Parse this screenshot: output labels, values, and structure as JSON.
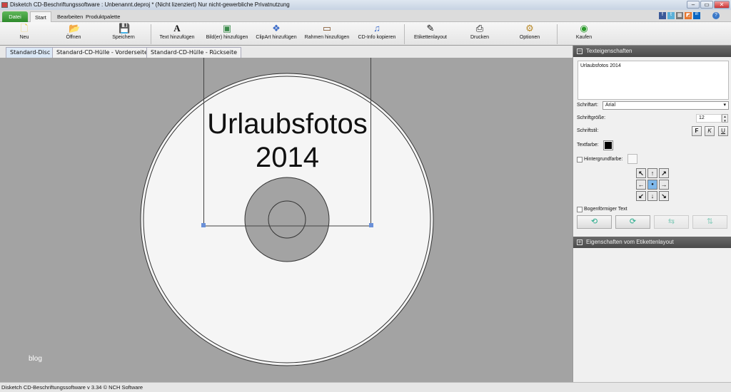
{
  "window": {
    "title": "Disketch CD-Beschriftungssoftware : Unbenannt.deproj * (Nicht lizenziert) Nur nicht-gewerbliche Privatnutzung",
    "min": "–",
    "max": "▭",
    "close": "✕"
  },
  "menu": {
    "tabs": [
      "Datei",
      "Start",
      "Bearbeiten",
      "Produktpalette"
    ],
    "social": [
      "f",
      "t",
      "▦",
      "◩",
      "in"
    ],
    "help": "?"
  },
  "toolbar": [
    {
      "label": "Neu",
      "icon": "new-icon",
      "glyph": "🗋"
    },
    {
      "label": "Öffnen",
      "icon": "open-icon",
      "glyph": "📂"
    },
    {
      "label": "Speichern",
      "icon": "save-icon",
      "glyph": "💾"
    },
    {
      "label": "Text hinzufügen",
      "icon": "text-icon",
      "glyph": "A"
    },
    {
      "label": "Bild(er) hinzufügen",
      "icon": "image-icon",
      "glyph": "▣"
    },
    {
      "label": "ClipArt hinzufügen",
      "icon": "clipart-icon",
      "glyph": "❖"
    },
    {
      "label": "Rahmen hinzufügen",
      "icon": "frame-icon",
      "glyph": "▭"
    },
    {
      "label": "CD-Info kopieren",
      "icon": "cd-info-icon",
      "glyph": "♫"
    },
    {
      "label": "Etikettenlayout",
      "icon": "label-layout-icon",
      "glyph": "✎"
    },
    {
      "label": "Drucken",
      "icon": "print-icon",
      "glyph": "⎙"
    },
    {
      "label": "Optionen",
      "icon": "options-icon",
      "glyph": "⚙"
    },
    {
      "label": "Kaufen",
      "icon": "buy-icon",
      "glyph": "◉"
    }
  ],
  "doc_tabs": [
    "Standard-Disc",
    "Standard-CD-Hülle - Vorderseite",
    "Standard-CD-Hülle - Rückseite"
  ],
  "canvas": {
    "text_line1": "Urlaubsfotos",
    "text_line2": "2014",
    "watermark": "blog"
  },
  "panel": {
    "header": "Texteigenschaften",
    "text_value": "Urlaubsfotos 2014",
    "font_label": "Schriftart:",
    "font_value": "Arial",
    "size_label": "Schriftgröße:",
    "size_value": "12",
    "style_label": "Schriftstil:",
    "bold": "F",
    "italic": "K",
    "underline": "U",
    "color_label": "Textfarbe:",
    "text_color": "#000000",
    "bg_label": "Hintergrundfarbe:",
    "arrows": [
      "↖",
      "↑",
      "↗",
      "←",
      "●",
      "→",
      "↙",
      "↓",
      "↘"
    ],
    "curved_label": "Bogenförmiger Text",
    "footer_header": "Eigenschaften vom Etikettenlayout"
  },
  "status": "Disketch CD-Beschriftungssoftware v 3.34 © NCH Software"
}
